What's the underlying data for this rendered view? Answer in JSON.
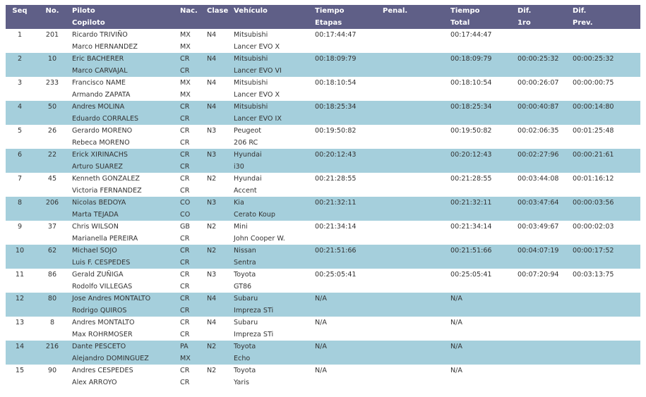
{
  "headers": {
    "seq": "Seq",
    "no": "No.",
    "piloto": "Piloto",
    "copiloto": "Copiloto",
    "nac": "Nac.",
    "clase": "Clase",
    "vehiculo": "Vehículo",
    "tiempo_etapas_1": "Tiempo",
    "tiempo_etapas_2": "Etapas",
    "penal": "Penal.",
    "tiempo_total_1": "Tiempo",
    "tiempo_total_2": "Total",
    "dif1ro_1": "Dif.",
    "dif1ro_2": "1ro",
    "difprev_1": "Dif.",
    "difprev_2": "Prev."
  },
  "rows": [
    {
      "seq": "1",
      "no": "201",
      "piloto": "Ricardo TRIVIÑO",
      "copiloto": "Marco HERNANDEZ",
      "nac1": "MX",
      "nac2": "MX",
      "clase": "N4",
      "veh1": "Mitsubishi",
      "veh2": "Lancer EVO X",
      "etapas": "00:17:44:47",
      "penal": "",
      "total": "00:17:44:47",
      "dif1ro": "",
      "difprev": ""
    },
    {
      "seq": "2",
      "no": "10",
      "piloto": "Eric BACHERER",
      "copiloto": "Marco CARVAJAL",
      "nac1": "CR",
      "nac2": "CR",
      "clase": "N4",
      "veh1": "Mitsubishi",
      "veh2": "Lancer EVO VI",
      "etapas": "00:18:09:79",
      "penal": "",
      "total": "00:18:09:79",
      "dif1ro": "00:00:25:32",
      "difprev": "00:00:25:32"
    },
    {
      "seq": "3",
      "no": "233",
      "piloto": "Francisco NAME",
      "copiloto": "Armando ZAPATA",
      "nac1": "MX",
      "nac2": "MX",
      "clase": "N4",
      "veh1": "Mitsubishi",
      "veh2": "Lancer EVO X",
      "etapas": "00:18:10:54",
      "penal": "",
      "total": "00:18:10:54",
      "dif1ro": "00:00:26:07",
      "difprev": "00:00:00:75"
    },
    {
      "seq": "4",
      "no": "50",
      "piloto": "Andres MOLINA",
      "copiloto": "Eduardo CORRALES",
      "nac1": "CR",
      "nac2": "CR",
      "clase": "N4",
      "veh1": "Mitsubishi",
      "veh2": "Lancer EVO IX",
      "etapas": "00:18:25:34",
      "penal": "",
      "total": "00:18:25:34",
      "dif1ro": "00:00:40:87",
      "difprev": "00:00:14:80"
    },
    {
      "seq": "5",
      "no": "26",
      "piloto": "Gerardo MORENO",
      "copiloto": "Rebeca MORENO",
      "nac1": "CR",
      "nac2": "CR",
      "clase": "N3",
      "veh1": "Peugeot",
      "veh2": "206 RC",
      "etapas": "00:19:50:82",
      "penal": "",
      "total": "00:19:50:82",
      "dif1ro": "00:02:06:35",
      "difprev": "00:01:25:48"
    },
    {
      "seq": "6",
      "no": "22",
      "piloto": "Erick XIRINACHS",
      "copiloto": "Arturo SUAREZ",
      "nac1": "CR",
      "nac2": "CR",
      "clase": "N3",
      "veh1": "Hyundai",
      "veh2": "i30",
      "etapas": "00:20:12:43",
      "penal": "",
      "total": "00:20:12:43",
      "dif1ro": "00:02:27:96",
      "difprev": "00:00:21:61"
    },
    {
      "seq": "7",
      "no": "45",
      "piloto": "Kenneth GONZALEZ",
      "copiloto": "Victoria FERNANDEZ",
      "nac1": "CR",
      "nac2": "CR",
      "clase": "N2",
      "veh1": "Hyundai",
      "veh2": "Accent",
      "etapas": "00:21:28:55",
      "penal": "",
      "total": "00:21:28:55",
      "dif1ro": "00:03:44:08",
      "difprev": "00:01:16:12"
    },
    {
      "seq": "8",
      "no": "206",
      "piloto": "Nicolas BEDOYA",
      "copiloto": "Marta TEJADA",
      "nac1": "CO",
      "nac2": "CO",
      "clase": "N3",
      "veh1": "Kia",
      "veh2": "Cerato Koup",
      "etapas": "00:21:32:11",
      "penal": "",
      "total": "00:21:32:11",
      "dif1ro": "00:03:47:64",
      "difprev": "00:00:03:56"
    },
    {
      "seq": "9",
      "no": "37",
      "piloto": "Chris WILSON",
      "copiloto": "Marianella PEREIRA",
      "nac1": "GB",
      "nac2": "CR",
      "clase": "N2",
      "veh1": "Mini",
      "veh2": "John Cooper W.",
      "etapas": "00:21:34:14",
      "penal": "",
      "total": "00:21:34:14",
      "dif1ro": "00:03:49:67",
      "difprev": "00:00:02:03"
    },
    {
      "seq": "10",
      "no": "62",
      "piloto": "Michael SOJO",
      "copiloto": "Luis F. CESPEDES",
      "nac1": "CR",
      "nac2": "CR",
      "clase": "N2",
      "veh1": "Nissan",
      "veh2": "Sentra",
      "etapas": "00:21:51:66",
      "penal": "",
      "total": "00:21:51:66",
      "dif1ro": "00:04:07:19",
      "difprev": "00:00:17:52"
    },
    {
      "seq": "11",
      "no": "86",
      "piloto": "Gerald ZUÑIGA",
      "copiloto": "Rodolfo VILLEGAS",
      "nac1": "CR",
      "nac2": "CR",
      "clase": "N3",
      "veh1": "Toyota",
      "veh2": "GT86",
      "etapas": "00:25:05:41",
      "penal": "",
      "total": "00:25:05:41",
      "dif1ro": "00:07:20:94",
      "difprev": "00:03:13:75"
    },
    {
      "seq": "12",
      "no": "80",
      "piloto": "Jose Andres MONTALTO",
      "copiloto": "Rodrigo QUIROS",
      "nac1": "CR",
      "nac2": "CR",
      "clase": "N4",
      "veh1": "Subaru",
      "veh2": "Impreza STi",
      "etapas": "N/A",
      "penal": "",
      "total": "N/A",
      "dif1ro": "",
      "difprev": ""
    },
    {
      "seq": "13",
      "no": "8",
      "piloto": "Andres MONTALTO",
      "copiloto": "Max ROHRMOSER",
      "nac1": "CR",
      "nac2": "CR",
      "clase": "N4",
      "veh1": "Subaru",
      "veh2": "Impreza STi",
      "etapas": "N/A",
      "penal": "",
      "total": "N/A",
      "dif1ro": "",
      "difprev": ""
    },
    {
      "seq": "14",
      "no": "216",
      "piloto": "Dante PESCETO",
      "copiloto": "Alejandro DOMINGUEZ",
      "nac1": "PA",
      "nac2": "MX",
      "clase": "N2",
      "veh1": "Toyota",
      "veh2": "Echo",
      "etapas": "N/A",
      "penal": "",
      "total": "N/A",
      "dif1ro": "",
      "difprev": ""
    },
    {
      "seq": "15",
      "no": "90",
      "piloto": "Andres CESPEDES",
      "copiloto": "Alex ARROYO",
      "nac1": "CR",
      "nac2": "CR",
      "clase": "N2",
      "veh1": "Toyota",
      "veh2": "Yaris",
      "etapas": "N/A",
      "penal": "",
      "total": "N/A",
      "dif1ro": "",
      "difprev": ""
    }
  ],
  "colors": {
    "header_bg": "#5f5f87",
    "header_text": "#ffffff",
    "alt_row_bg": "#a5cfdc",
    "text": "#333333"
  }
}
